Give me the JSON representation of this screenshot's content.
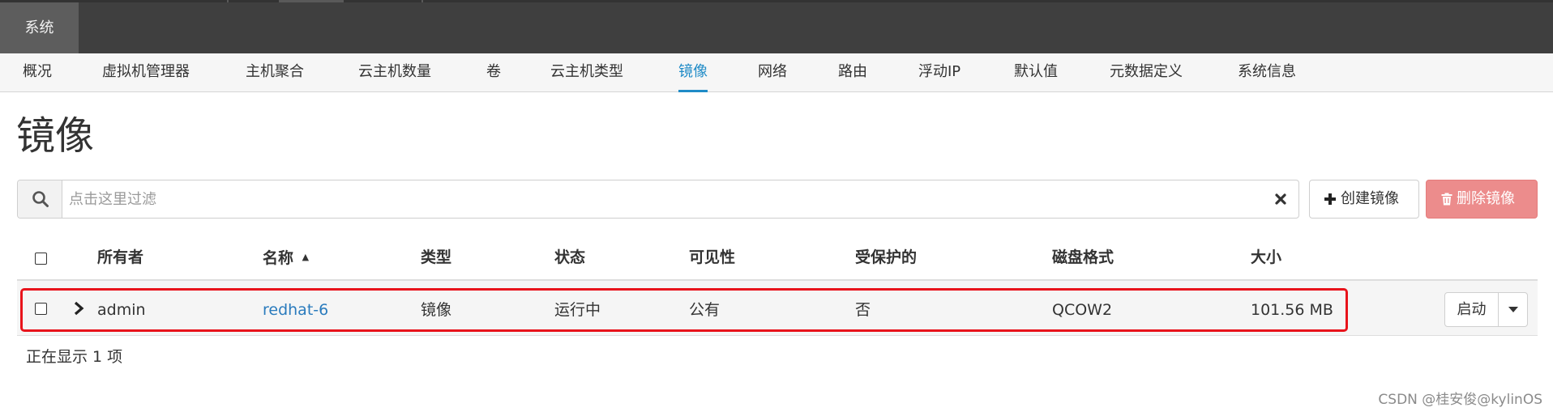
{
  "top_tab": "系统",
  "subnav": [
    "概况",
    "虚拟机管理器",
    "主机聚合",
    "云主机数量",
    "卷",
    "云主机类型",
    "镜像",
    "网络",
    "路由",
    "浮动IP",
    "默认值",
    "元数据定义",
    "系统信息"
  ],
  "active_subnav": "镜像",
  "page_title": "镜像",
  "filter": {
    "placeholder": "点击这里过滤",
    "value": ""
  },
  "actions": {
    "create": "创建镜像",
    "delete": "删除镜像"
  },
  "table": {
    "headers": [
      "所有者",
      "名称",
      "类型",
      "状态",
      "可见性",
      "受保护的",
      "磁盘格式",
      "大小"
    ],
    "sort_indicator": "▲",
    "rows": [
      {
        "owner": "admin",
        "name": "redhat-6",
        "type": "镜像",
        "status": "运行中",
        "visibility": "公有",
        "protected": "否",
        "disk_format": "QCOW2",
        "size": "101.56 MB",
        "action": "启动"
      }
    ]
  },
  "footer_count": "正在显示 1 项",
  "watermark": "CSDN @桂安俊@kylinOS",
  "colors": {
    "accent": "#1f8bc7",
    "danger": "#ec8c8c",
    "highlight": "#e8131b",
    "topbar": "#3f3f3f"
  }
}
